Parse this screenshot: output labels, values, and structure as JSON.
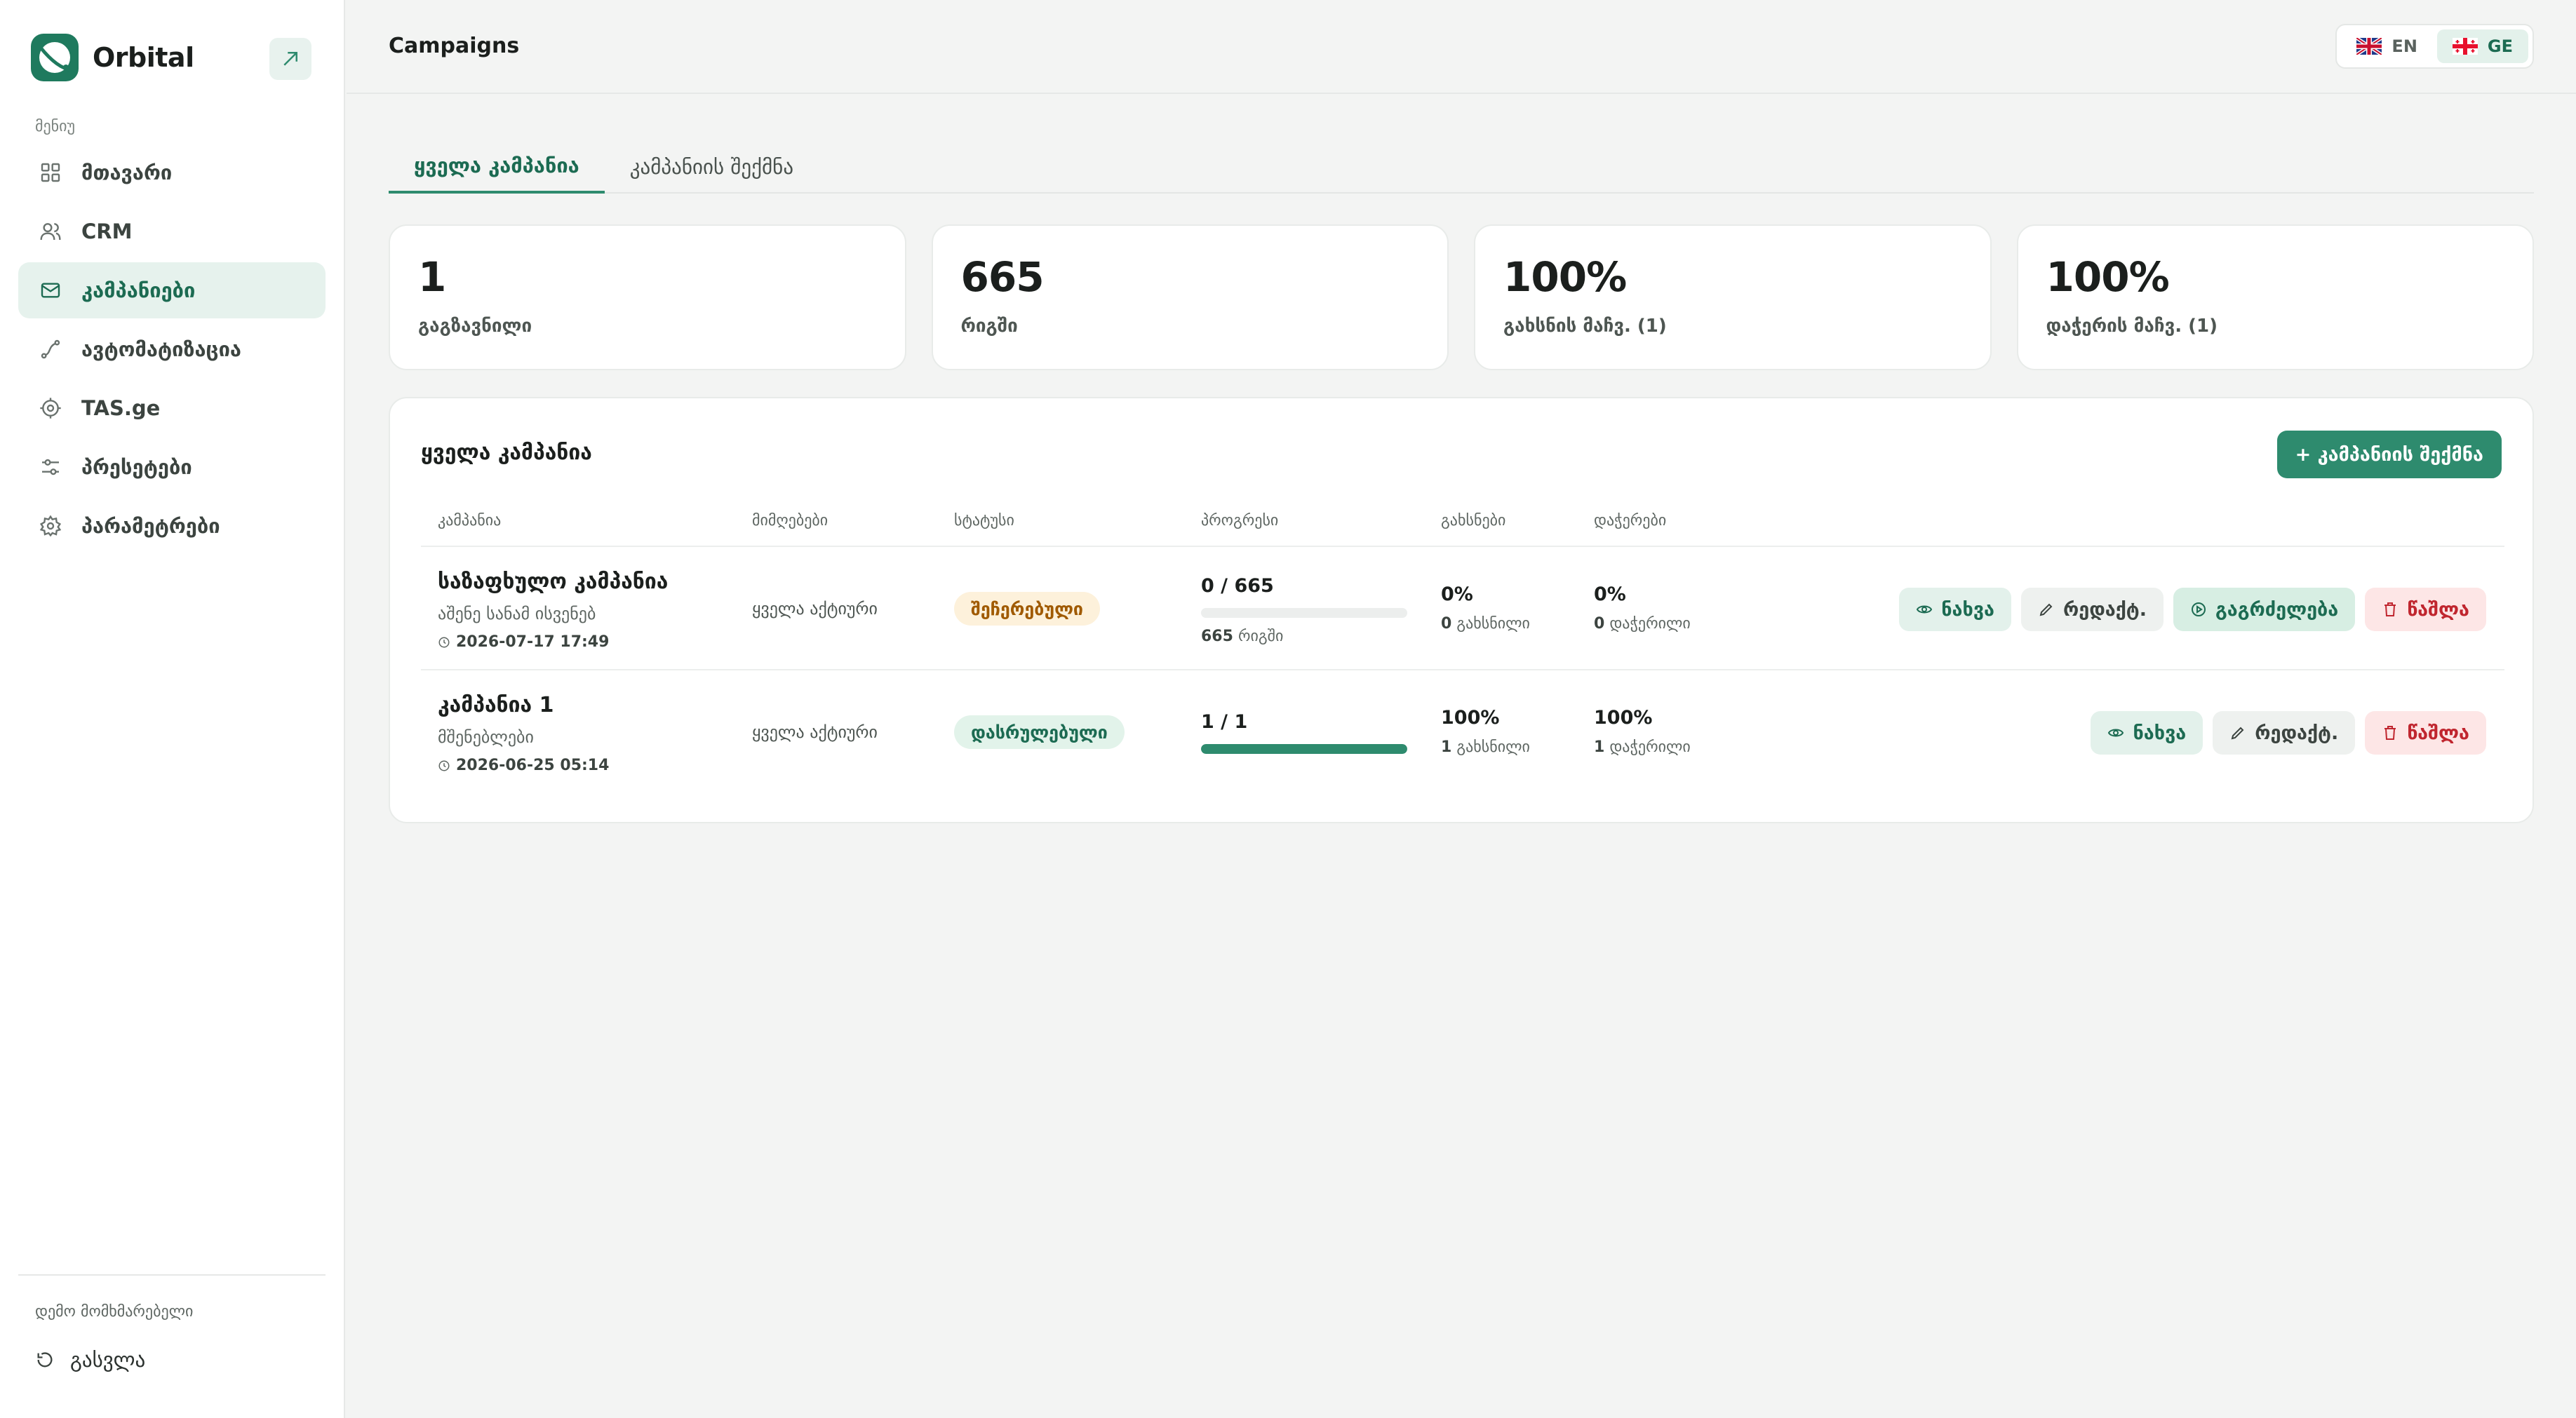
{
  "sidebar": {
    "brand": "Orbital",
    "section_label": "მენიუ",
    "items": [
      {
        "label": "მთავარი",
        "icon": "grid-icon"
      },
      {
        "label": "CRM",
        "icon": "users-icon"
      },
      {
        "label": "კამპანიები",
        "icon": "mail-icon"
      },
      {
        "label": "ავტომატიზაცია",
        "icon": "workflow-icon"
      },
      {
        "label": "TAS.ge",
        "icon": "target-icon"
      },
      {
        "label": "პრესეტები",
        "icon": "sliders-icon"
      },
      {
        "label": "პარამეტრები",
        "icon": "gear-icon"
      }
    ],
    "user_label": "დემო მომხმარებელი",
    "logout_label": "გასვლა"
  },
  "header": {
    "title": "Campaigns",
    "lang": {
      "en": "EN",
      "ge": "GE",
      "active": "GE"
    }
  },
  "tabs": {
    "all": "ყველა კამპანია",
    "create": "კამპანიის შექმნა"
  },
  "stats": [
    {
      "value": "1",
      "label": "გაგზავნილი"
    },
    {
      "value": "665",
      "label": "რიგში"
    },
    {
      "value": "100%",
      "label": "გახსნის მაჩვ. (1)"
    },
    {
      "value": "100%",
      "label": "დაჭერის მაჩვ. (1)"
    }
  ],
  "table": {
    "title": "ყველა კამპანია",
    "create_button": "+ კამპანიის შექმნა",
    "columns": {
      "campaign": "კამპანია",
      "recipients": "მიმღებები",
      "status": "სტატუსი",
      "progress": "პროგრესი",
      "opens": "გახსნები",
      "clicks": "დაჭერები"
    },
    "rows": [
      {
        "name": "საზაფხულო კამპანია",
        "subtitle": "აშენე სანამ ისვენებ",
        "date": "2026-07-17 17:49",
        "recipients": "ყველა აქტიური",
        "status": "შეჩერებული",
        "progress_text": "0 / 665",
        "progress_fraction": 0,
        "progress_count": "665",
        "progress_sub": "რიგში",
        "opens_pct": "0%",
        "opens_count": "0",
        "opens_sub": "გახსნილი",
        "clicks_pct": "0%",
        "clicks_count": "0",
        "clicks_sub": "დაჭერილი",
        "actions": {
          "view": "ნახვა",
          "edit": "რედაქტ.",
          "resume": "გაგრძელება",
          "delete": "წაშლა"
        }
      },
      {
        "name": "კამპანია 1",
        "subtitle": "მშენებლები",
        "date": "2026-06-25 05:14",
        "recipients": "ყველა აქტიური",
        "status": "დასრულებული",
        "progress_text": "1 / 1",
        "progress_fraction": 1,
        "opens_pct": "100%",
        "opens_count": "1",
        "opens_sub": "გახსნილი",
        "clicks_pct": "100%",
        "clicks_count": "1",
        "clicks_sub": "დაჭერილი",
        "actions": {
          "view": "ნახვა",
          "edit": "რედაქტ.",
          "delete": "წაშლა"
        }
      }
    ]
  },
  "colors": {
    "accent": "#2e8b6e",
    "accent_soft": "#e6f2ed",
    "paused": "#a05a00",
    "danger": "#c0262f"
  }
}
